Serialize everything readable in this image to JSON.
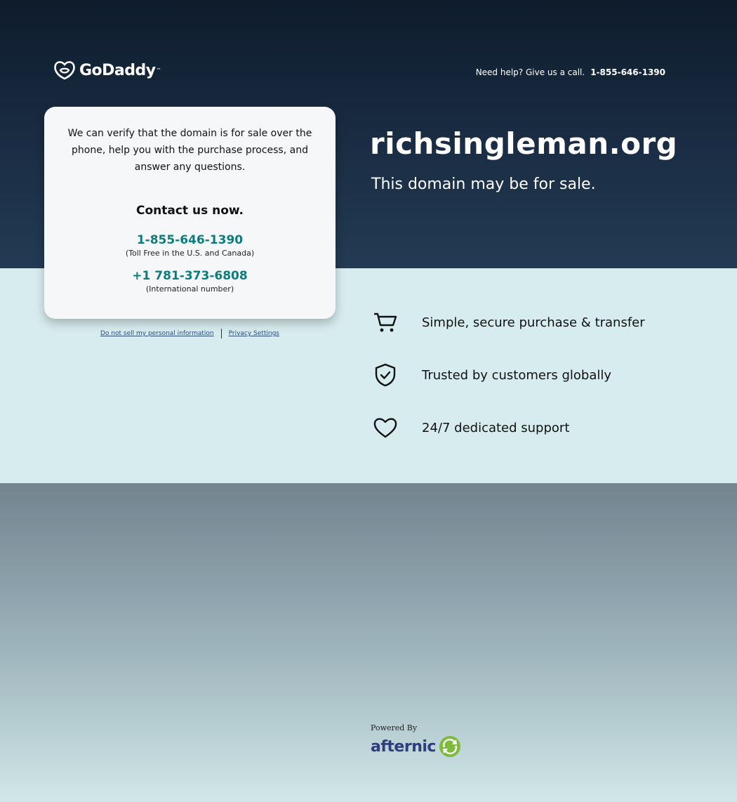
{
  "header": {
    "logo_text": "GoDaddy",
    "help_text": "Need help? Give us a call.",
    "help_phone": "1-855-646-1390"
  },
  "card": {
    "intro": "We can verify that the domain is for sale over the phone, help you with the purchase process, and answer any questions.",
    "cta": "Contact us now.",
    "phone_tollfree": "1-855-646-1390",
    "phone_tollfree_note": "(Toll Free in the U.S. and Canada)",
    "phone_intl": "+1 781-373-6808",
    "phone_intl_note": "(International number)"
  },
  "legal": {
    "do_not_sell": "Do not sell my personal information",
    "privacy": "Privacy Settings"
  },
  "hero": {
    "domain": "richsingleman.org",
    "tagline": "This domain may be for sale."
  },
  "features": [
    {
      "icon": "cart-icon",
      "label": "Simple, secure purchase & transfer"
    },
    {
      "icon": "shield-check-icon",
      "label": "Trusted by customers globally"
    },
    {
      "icon": "heart-icon",
      "label": "24/7 dedicated support"
    }
  ],
  "footer": {
    "powered_by": "Powered By",
    "brand": "afternic"
  },
  "colors": {
    "hero_bg": "#1a2d44",
    "phone_link": "#0c7d7d",
    "band_bg": "#d7ecee"
  }
}
